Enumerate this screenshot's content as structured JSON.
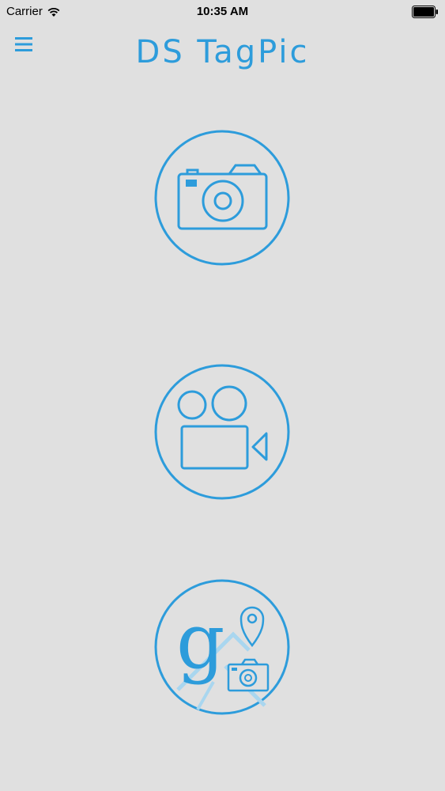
{
  "status_bar": {
    "carrier": "Carrier",
    "time": "10:35 AM"
  },
  "header": {
    "title": "DS TagPic",
    "menu_icon": "hamburger-menu-icon"
  },
  "actions": [
    {
      "id": "photo",
      "icon": "camera-icon"
    },
    {
      "id": "video",
      "icon": "video-camera-icon"
    },
    {
      "id": "geotag",
      "icon": "google-map-camera-icon"
    }
  ],
  "colors": {
    "accent": "#2d9cdb",
    "background": "#e0e0e0"
  }
}
